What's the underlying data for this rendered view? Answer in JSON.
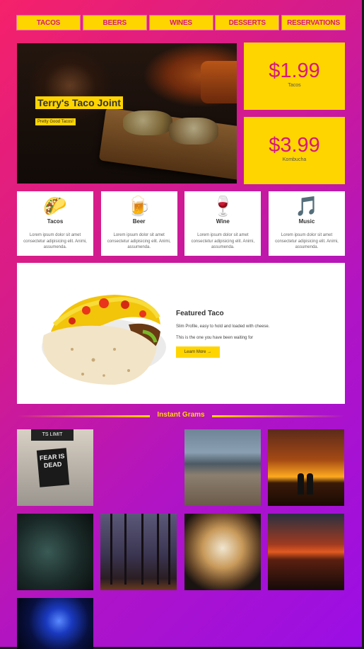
{
  "nav": {
    "items": [
      {
        "label": "TACOS",
        "name": "nav-tacos"
      },
      {
        "label": "BEERS",
        "name": "nav-beers"
      },
      {
        "label": "WINES",
        "name": "nav-wines"
      },
      {
        "label": "DESSERTS",
        "name": "nav-desserts"
      },
      {
        "label": "RESERVATIONS",
        "name": "nav-reservations"
      }
    ]
  },
  "hero": {
    "title": "Terry's Taco Joint",
    "subtitle": "Pretty Good Tacos!"
  },
  "prices": [
    {
      "value": "$1.99",
      "label": "Tacos"
    },
    {
      "value": "$3.99",
      "label": "Kombucha"
    }
  ],
  "features": [
    {
      "icon": "🌮",
      "icon_name": "taco-icon",
      "name": "Tacos",
      "text": "Lorem ipsum dolor sit amet consectetur adipisicing elit. Animi, assumenda."
    },
    {
      "icon": "🍺",
      "icon_name": "beer-icon",
      "name": "Beer",
      "text": "Lorem ipsum dolor sit amet consectetur adipisicing elit. Animi, assumenda."
    },
    {
      "icon": "🍷",
      "icon_name": "wine-icon",
      "name": "Wine",
      "text": "Lorem ipsum dolor sit amet consectetur adipisicing elit. Animi, assumenda."
    },
    {
      "icon": "🎵",
      "icon_name": "music-icon",
      "name": "Music",
      "text": "Lorem ipsum dolor sit amet consectetur adipisicing elit. Animi, assumenda."
    }
  ],
  "featured": {
    "title": "Featured Taco",
    "line1": "Slim Profile, easy to hold and loaded with cheese.",
    "line2": "This is the one you have been waiting for",
    "button": "Learn More →"
  },
  "instagram": {
    "title": "Instant Grams",
    "photo1_sign_top": "TS LIMIT",
    "photo1_sign": "FEAR IS DEAD"
  },
  "colors": {
    "accent_yellow": "#ffd500",
    "accent_pink": "#d8177e",
    "background_start": "#f5216a",
    "background_end": "#9a0ee6"
  }
}
